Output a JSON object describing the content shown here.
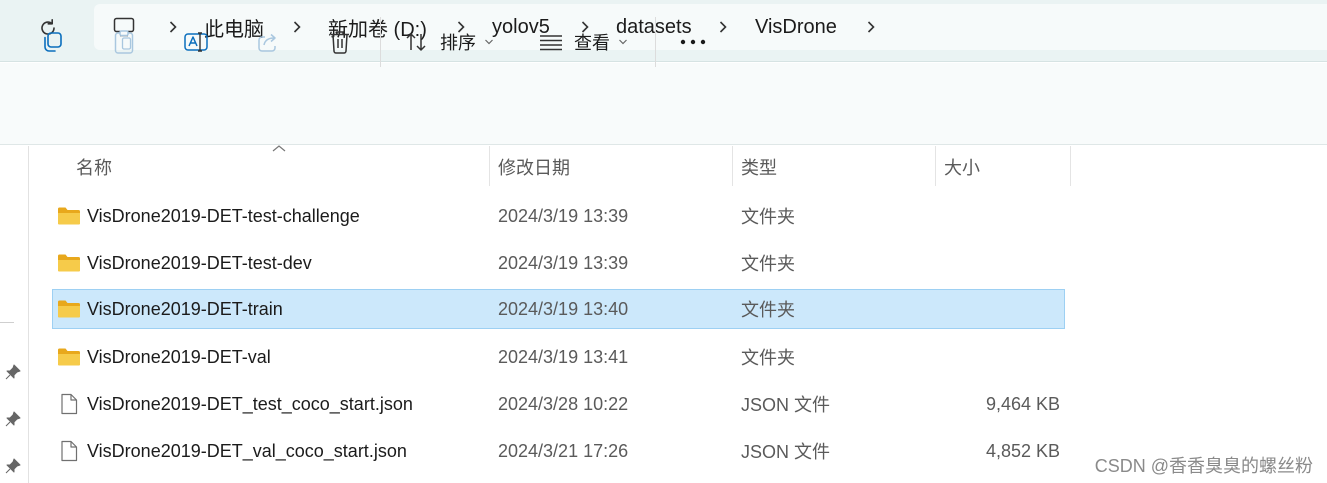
{
  "window": {
    "title": "VisDrone"
  },
  "breadcrumb": {
    "items": [
      "此电脑",
      "新加卷 (D:)",
      "yolov5",
      "datasets",
      "VisDrone"
    ]
  },
  "toolbar": {
    "sort_label": "排序",
    "view_label": "查看",
    "more_label": "•••"
  },
  "columns": {
    "name": "名称",
    "date": "修改日期",
    "type": "类型",
    "size": "大小"
  },
  "rows": [
    {
      "icon": "folder-icon",
      "name": "VisDrone2019-DET-test-challenge",
      "date": "2024/3/19 13:39",
      "type": "文件夹",
      "size": ""
    },
    {
      "icon": "folder-icon",
      "name": "VisDrone2019-DET-test-dev",
      "date": "2024/3/19 13:39",
      "type": "文件夹",
      "size": ""
    },
    {
      "icon": "folder-icon",
      "name": "VisDrone2019-DET-train",
      "date": "2024/3/19 13:40",
      "type": "文件夹",
      "size": "",
      "selected": true
    },
    {
      "icon": "folder-icon",
      "name": "VisDrone2019-DET-val",
      "date": "2024/3/19 13:41",
      "type": "文件夹",
      "size": ""
    },
    {
      "icon": "file-icon",
      "name": "VisDrone2019-DET_test_coco_start.json",
      "date": "2024/3/28 10:22",
      "type": "JSON 文件",
      "size": "9,464 KB"
    },
    {
      "icon": "file-icon",
      "name": "VisDrone2019-DET_val_coco_start.json",
      "date": "2024/3/21 17:26",
      "type": "JSON 文件",
      "size": "4,852 KB"
    }
  ],
  "watermark": "CSDN @香香臭臭的螺丝粉",
  "colors": {
    "selection_bg": "#cce8fb",
    "selection_border": "#9dd0f3",
    "folder": "#f3c443",
    "accent": "#0a6ebd"
  }
}
